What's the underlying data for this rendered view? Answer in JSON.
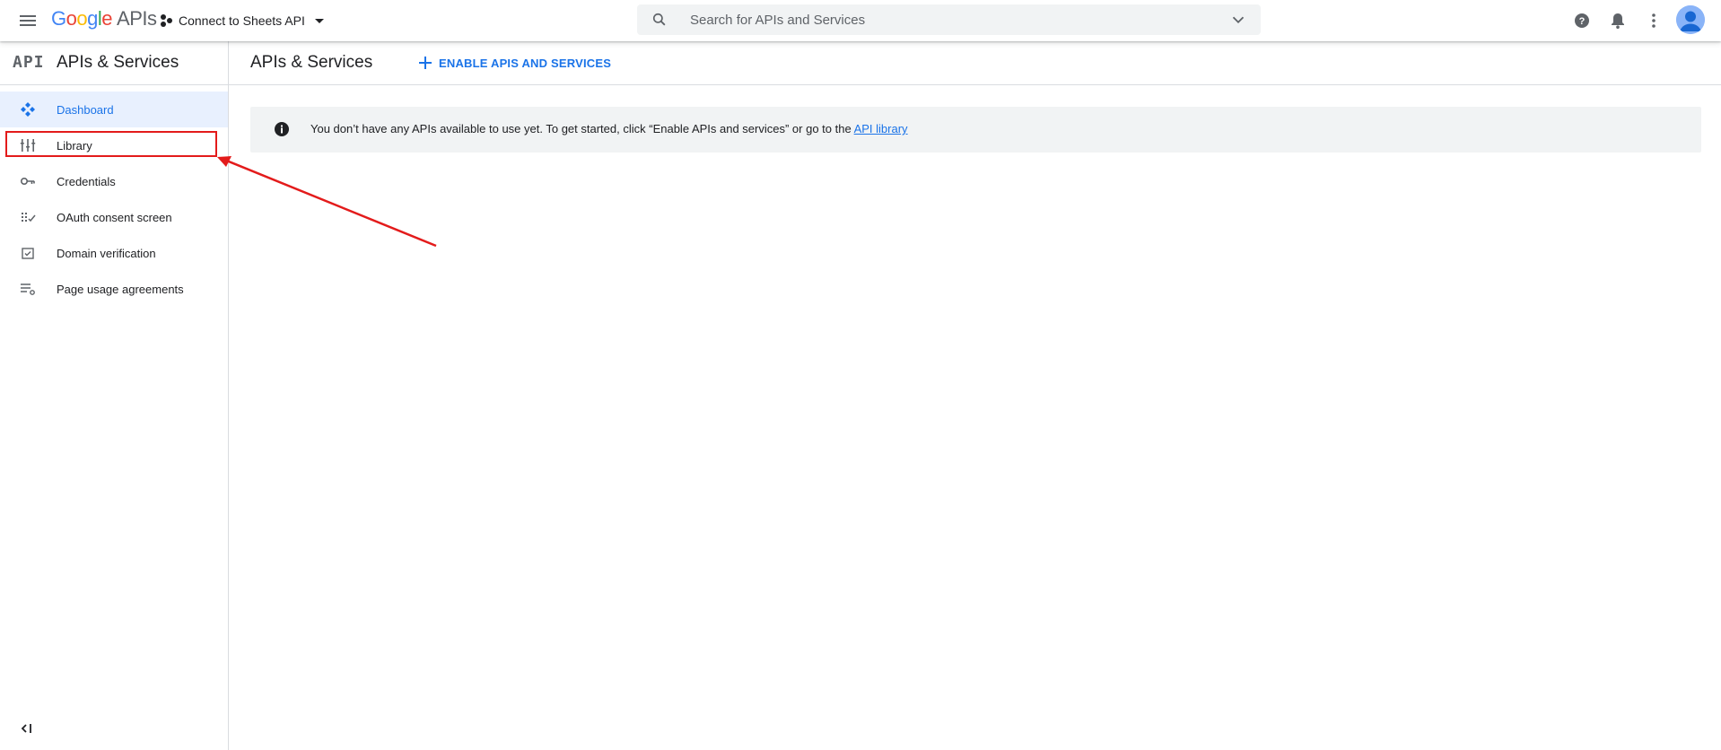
{
  "topbar": {
    "logo_google": [
      "G",
      "o",
      "o",
      "g",
      "l",
      "e"
    ],
    "logo_apis": "APIs",
    "project_name": "Connect to Sheets API",
    "search_placeholder": "Search for APIs and Services"
  },
  "sidebar": {
    "api_logo": "API",
    "title": "APIs & Services",
    "items": [
      {
        "label": "Dashboard",
        "icon": "dashboard-icon",
        "active": true
      },
      {
        "label": "Library",
        "icon": "library-icon",
        "active": false
      },
      {
        "label": "Credentials",
        "icon": "key-icon",
        "active": false
      },
      {
        "label": "OAuth consent screen",
        "icon": "oauth-icon",
        "active": false
      },
      {
        "label": "Domain verification",
        "icon": "domain-check-icon",
        "active": false
      },
      {
        "label": "Page usage agreements",
        "icon": "settings-list-icon",
        "active": false
      }
    ]
  },
  "main": {
    "title": "APIs & Services",
    "enable_button": "ENABLE APIS AND SERVICES",
    "banner_text": "You don’t have any APIs available to use yet. To get started, click “Enable APIs and services” or go to the ",
    "banner_link": "API library"
  },
  "colors": {
    "accent": "#1a73e8",
    "annotation": "#e31b1b",
    "active_bg": "#e8f0fe"
  }
}
